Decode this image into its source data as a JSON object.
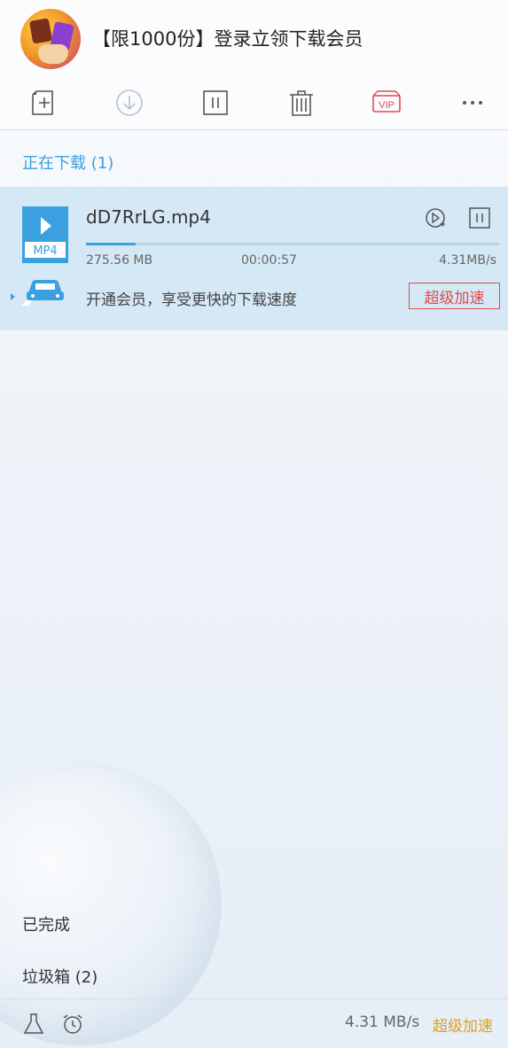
{
  "header": {
    "title": "【限1000份】登录立领下载会员"
  },
  "toolbar": {
    "buttons": [
      {
        "name": "new-task",
        "icon": "plus-square-icon"
      },
      {
        "name": "start",
        "icon": "download-circle-icon"
      },
      {
        "name": "pause",
        "icon": "pause-square-icon"
      },
      {
        "name": "delete",
        "icon": "trash-icon"
      },
      {
        "name": "vip",
        "icon": "vip-icon",
        "label": "VIP",
        "color": "#e04a4a"
      },
      {
        "name": "more",
        "icon": "more-dots-icon"
      }
    ]
  },
  "downloading": {
    "heading": "正在下载 (1)",
    "items": [
      {
        "type_label": "MP4",
        "filename": "dD7RrLG.mp4",
        "size": "275.56 MB",
        "time": "00:00:57",
        "speed": "4.31MB/s",
        "progress": 0.12,
        "promo_text": "开通会员，享受更快的下载速度",
        "boost_label": "超级加速"
      }
    ]
  },
  "sidebar": {
    "completed": "已完成",
    "trash": "垃圾箱 (2)"
  },
  "footer": {
    "speed": "4.31 MB/s",
    "accel": "超级加速"
  },
  "colors": {
    "accent": "#3aa0e0",
    "vip": "#e04a4a",
    "accel": "#e0a020"
  }
}
